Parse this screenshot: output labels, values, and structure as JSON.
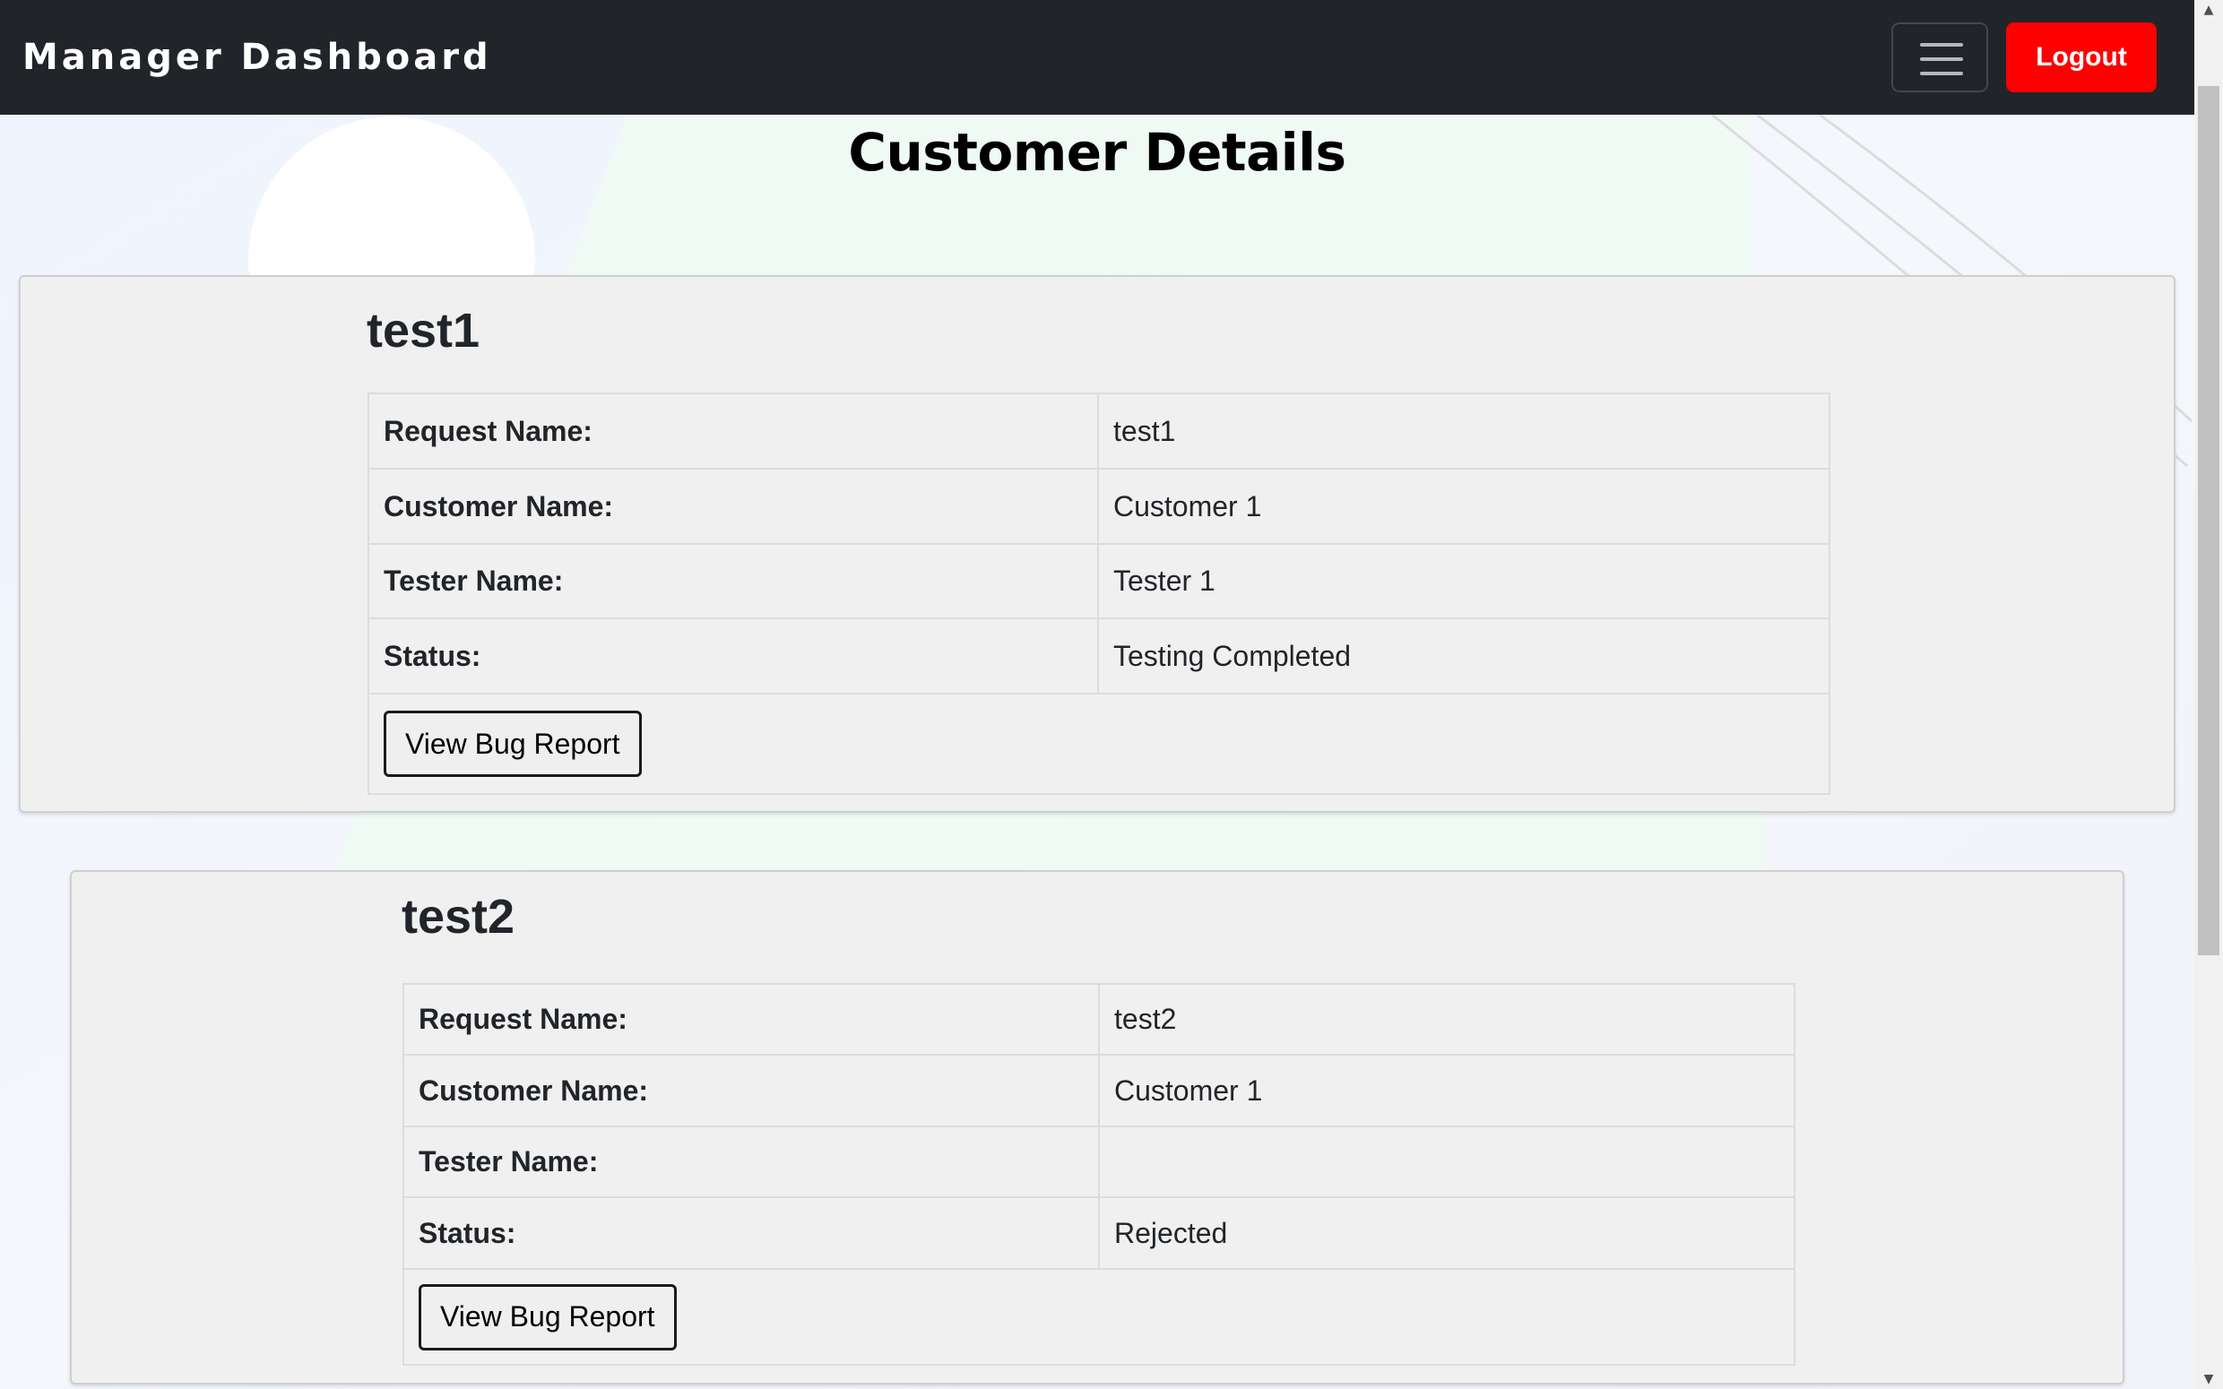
{
  "navbar": {
    "brand": "Manager Dashboard",
    "logout_label": "Logout"
  },
  "page": {
    "title": "Customer Details"
  },
  "colors": {
    "navbar_bg": "#212529",
    "logout_bg": "#ff0000",
    "card_bg": "#f0f0f0"
  },
  "cards": [
    {
      "title": "test1",
      "rows": [
        {
          "label": "Request Name:",
          "value": "test1"
        },
        {
          "label": "Customer Name:",
          "value": "Customer 1"
        },
        {
          "label": "Tester Name:",
          "value": "Tester 1"
        },
        {
          "label": "Status:",
          "value": "Testing Completed"
        }
      ],
      "button_label": "View Bug Report"
    },
    {
      "title": "test2",
      "rows": [
        {
          "label": "Request Name:",
          "value": "test2"
        },
        {
          "label": "Customer Name:",
          "value": "Customer 1"
        },
        {
          "label": "Tester Name:",
          "value": ""
        },
        {
          "label": "Status:",
          "value": "Rejected"
        }
      ],
      "button_label": "View Bug Report"
    }
  ]
}
